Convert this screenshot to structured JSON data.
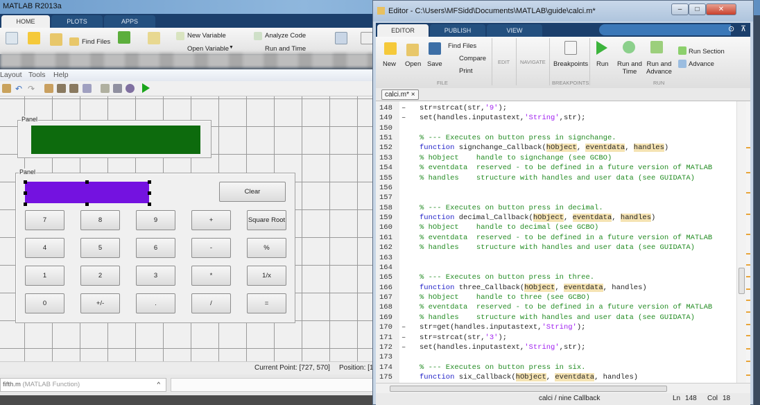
{
  "main_window": {
    "title": "MATLAB R2013a",
    "tabs": [
      "HOME",
      "PLOTS",
      "APPS"
    ],
    "ribbon": {
      "find_files": "Find Files",
      "new_variable": "New Variable",
      "open_variable": "Open Variable",
      "analyze_code": "Analyze Code",
      "run_and_time": "Run and Time"
    },
    "menu": [
      "Layout",
      "Tools",
      "Help"
    ]
  },
  "guide": {
    "panel1_label": "Panel",
    "panel2_label": "Panel",
    "display_color": "#0d6b0d",
    "input_color": "#7412e0",
    "clear": "Clear",
    "buttons": [
      [
        "7",
        "8",
        "9",
        "+",
        "Square Root"
      ],
      [
        "4",
        "5",
        "6",
        "-",
        "%"
      ],
      [
        "1",
        "2",
        "3",
        "*",
        "1/x"
      ],
      [
        "0",
        "+/-",
        ".",
        "/",
        "="
      ]
    ]
  },
  "status": {
    "current_point": "Current Point:  [727, 570]",
    "position": "Position: [1"
  },
  "bottom": {
    "file_name": "fifth.m",
    "file_type": "(MATLAB Function)"
  },
  "editor": {
    "title": "Editor - C:\\Users\\MFSidd\\Documents\\MATLAB\\guide\\calci.m*",
    "tabs": [
      "EDITOR",
      "PUBLISH",
      "VIEW"
    ],
    "ribbon": {
      "new": "New",
      "open": "Open",
      "save": "Save",
      "find_files": "Find Files",
      "compare": "Compare",
      "print": "Print",
      "edit": "EDIT",
      "navigate": "NAVIGATE",
      "breakpoints": "Breakpoints",
      "run": "Run",
      "run_and_time": "Run and\nTime",
      "run_and_advance": "Run and\nAdvance",
      "run_section": "Run Section",
      "advance": "Advance",
      "groups": {
        "file": "FILE",
        "breakpoints": "BREAKPOINTS",
        "run": "RUN"
      }
    },
    "doc_tab": "calci.m*",
    "lines": [
      {
        "n": "148",
        "d": true,
        "seg": [
          [
            "n",
            "str=strcat(str,"
          ],
          [
            "s",
            "'9'"
          ],
          [
            "n",
            ");"
          ]
        ]
      },
      {
        "n": "149",
        "d": true,
        "seg": [
          [
            "n",
            "set(handles.inputastext,"
          ],
          [
            "s",
            "'String'"
          ],
          [
            "n",
            ",str);"
          ]
        ]
      },
      {
        "n": "150",
        "seg": []
      },
      {
        "n": "151",
        "seg": [
          [
            "c",
            "% --- Executes on button press in signchange."
          ]
        ]
      },
      {
        "n": "152",
        "seg": [
          [
            "k",
            "function "
          ],
          [
            "n",
            "signchange_Callback("
          ],
          [
            "h",
            "hObject"
          ],
          [
            "n",
            ", "
          ],
          [
            "h",
            "eventdata"
          ],
          [
            "n",
            ", "
          ],
          [
            "h",
            "handles"
          ],
          [
            "n",
            ")"
          ]
        ]
      },
      {
        "n": "153",
        "seg": [
          [
            "c",
            "% hObject    handle to signchange (see GCBO)"
          ]
        ]
      },
      {
        "n": "154",
        "seg": [
          [
            "c",
            "% eventdata  reserved - to be defined in a future version of MATLAB"
          ]
        ]
      },
      {
        "n": "155",
        "seg": [
          [
            "c",
            "% handles    structure with handles and user data (see GUIDATA)"
          ]
        ]
      },
      {
        "n": "156",
        "seg": []
      },
      {
        "n": "157",
        "seg": []
      },
      {
        "n": "158",
        "seg": [
          [
            "c",
            "% --- Executes on button press in decimal."
          ]
        ]
      },
      {
        "n": "159",
        "seg": [
          [
            "k",
            "function "
          ],
          [
            "n",
            "decimal_Callback("
          ],
          [
            "h",
            "hObject"
          ],
          [
            "n",
            ", "
          ],
          [
            "h",
            "eventdata"
          ],
          [
            "n",
            ", "
          ],
          [
            "h",
            "handles"
          ],
          [
            "n",
            ")"
          ]
        ]
      },
      {
        "n": "160",
        "seg": [
          [
            "c",
            "% hObject    handle to decimal (see GCBO)"
          ]
        ]
      },
      {
        "n": "161",
        "seg": [
          [
            "c",
            "% eventdata  reserved - to be defined in a future version of MATLAB"
          ]
        ]
      },
      {
        "n": "162",
        "seg": [
          [
            "c",
            "% handles    structure with handles and user data (see GUIDATA)"
          ]
        ]
      },
      {
        "n": "163",
        "seg": []
      },
      {
        "n": "164",
        "seg": []
      },
      {
        "n": "165",
        "seg": [
          [
            "c",
            "% --- Executes on button press in three."
          ]
        ]
      },
      {
        "n": "166",
        "seg": [
          [
            "k",
            "function "
          ],
          [
            "n",
            "three_Callback("
          ],
          [
            "h",
            "hObject"
          ],
          [
            "n",
            ", "
          ],
          [
            "h",
            "eventdata"
          ],
          [
            "n",
            ", handles)"
          ]
        ]
      },
      {
        "n": "167",
        "seg": [
          [
            "c",
            "% hObject    handle to three (see GCBO)"
          ]
        ]
      },
      {
        "n": "168",
        "seg": [
          [
            "c",
            "% eventdata  reserved - to be defined in a future version of MATLAB"
          ]
        ]
      },
      {
        "n": "169",
        "seg": [
          [
            "c",
            "% handles    structure with handles and user data (see GUIDATA)"
          ]
        ]
      },
      {
        "n": "170",
        "d": true,
        "seg": [
          [
            "n",
            "str=get(handles.inputastext,"
          ],
          [
            "s",
            "'String'"
          ],
          [
            "n",
            ");"
          ]
        ]
      },
      {
        "n": "171",
        "d": true,
        "seg": [
          [
            "n",
            "str=strcat(str,"
          ],
          [
            "s",
            "'3'"
          ],
          [
            "n",
            ");"
          ]
        ]
      },
      {
        "n": "172",
        "d": true,
        "seg": [
          [
            "n",
            "set(handles.inputastext,"
          ],
          [
            "s",
            "'String'"
          ],
          [
            "n",
            ",str);"
          ]
        ]
      },
      {
        "n": "173",
        "seg": []
      },
      {
        "n": "174",
        "seg": [
          [
            "c",
            "% --- Executes on button press in six."
          ]
        ]
      },
      {
        "n": "175",
        "seg": [
          [
            "k",
            "function "
          ],
          [
            "n",
            "six_Callback("
          ],
          [
            "h",
            "hObject"
          ],
          [
            "n",
            ", "
          ],
          [
            "h",
            "eventdata"
          ],
          [
            "n",
            ", handles)"
          ]
        ]
      }
    ],
    "status": {
      "function": "calci / nine Callback",
      "ln_label": "Ln",
      "ln": "148",
      "col_label": "Col",
      "col": "18"
    }
  }
}
